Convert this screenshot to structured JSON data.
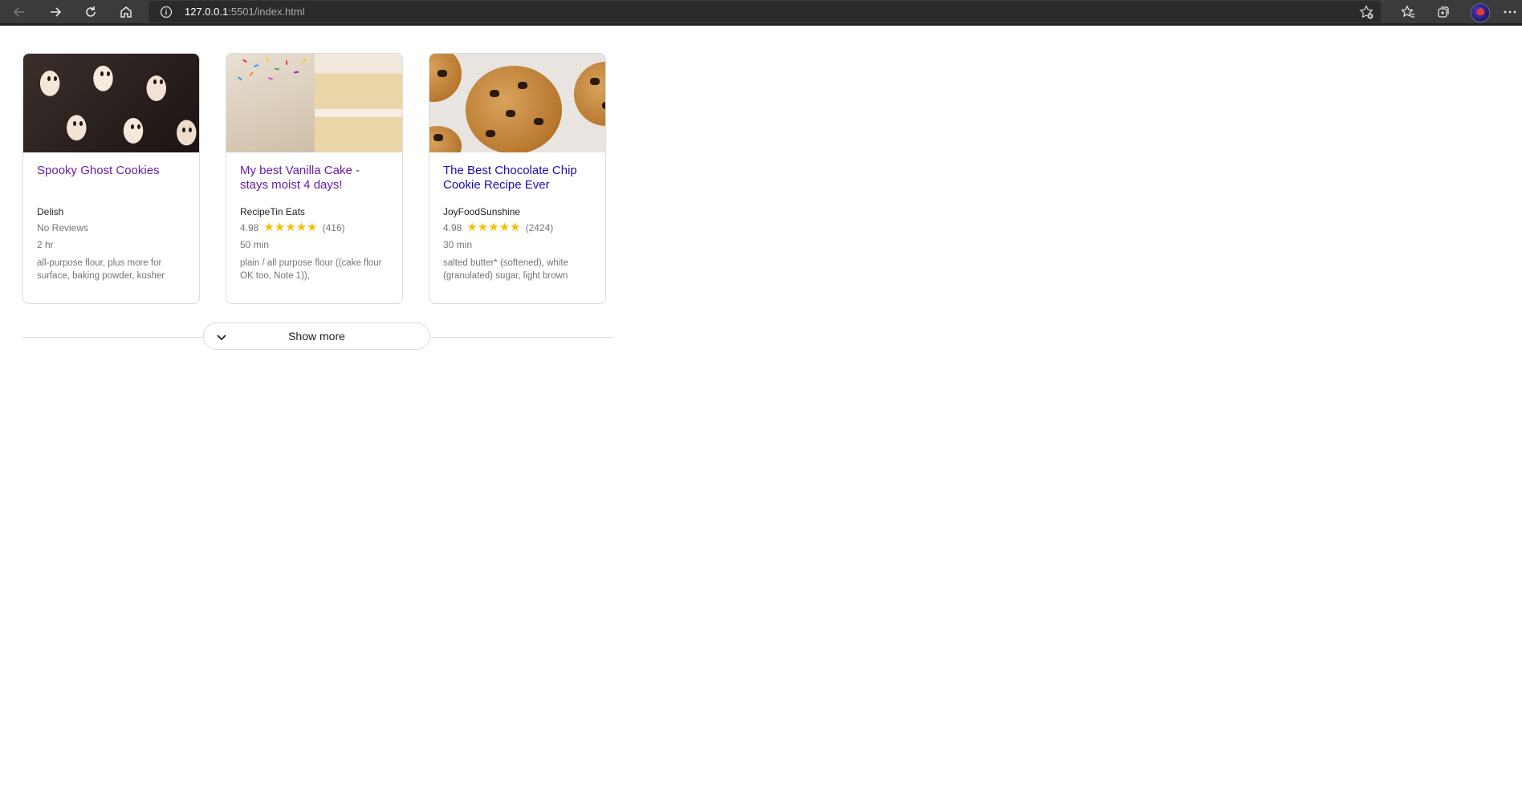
{
  "browser": {
    "url_host": "127.0.0.1",
    "url_path": ":5501/index.html",
    "icons": [
      "back-icon",
      "forward-icon",
      "refresh-icon",
      "home-icon",
      "info-icon",
      "add-favorite-icon",
      "favorites-icon",
      "collections-icon",
      "profile-avatar",
      "more-icon"
    ]
  },
  "recipes": [
    {
      "title": "Spooky Ghost Cookies",
      "source": "Delish",
      "rating_text": "No Reviews",
      "time": "2 hr",
      "ingredients": "all-purpose flour, plus more for surface, baking powder, kosher"
    },
    {
      "title": "My best Vanilla Cake - stays moist 4 days!",
      "source": "RecipeTin Eats",
      "rating": "4.98",
      "stars": "★★★★★",
      "reviews": "(416)",
      "time": "50 min",
      "ingredients": "plain / all purpose flour ((cake flour OK too, Note 1)),"
    },
    {
      "title": "The Best Chocolate Chip Cookie Recipe Ever",
      "source": "JoyFoodSunshine",
      "rating": "4.98",
      "stars": "★★★★★",
      "reviews": "(2424)",
      "time": "30 min",
      "ingredients": "salted butter* (softened), white (granulated) sugar, light brown"
    }
  ],
  "show_more": {
    "label": "Show more"
  },
  "colors": {
    "visited_link": "#681da8",
    "link": "#1a0dab",
    "star": "#fbbc04",
    "muted": "#70757a"
  }
}
